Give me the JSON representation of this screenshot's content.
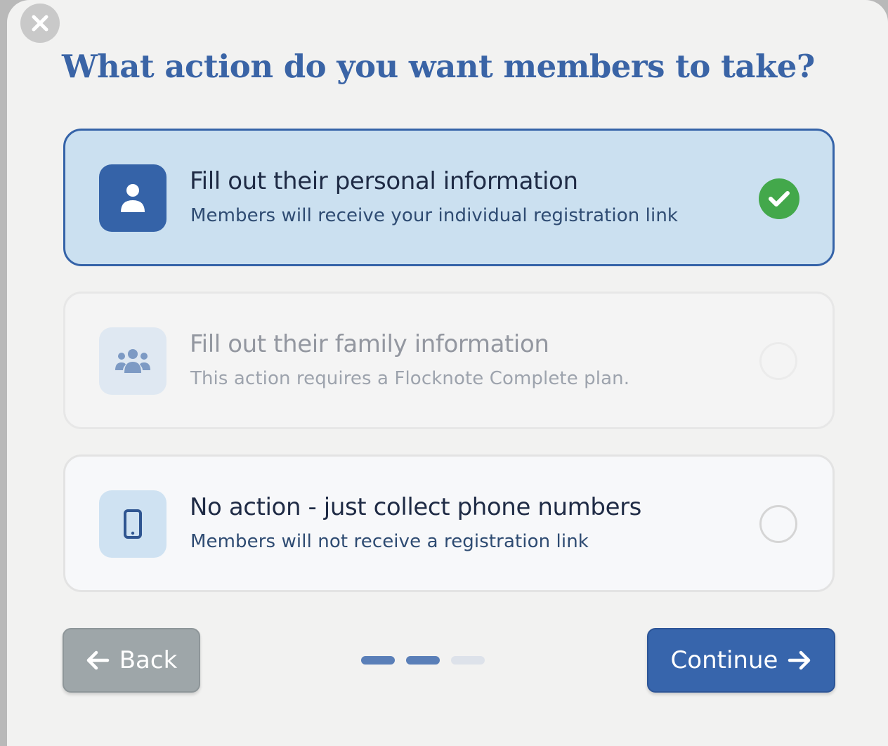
{
  "dialog": {
    "title": "What action do you want members to take?"
  },
  "options": [
    {
      "title": "Fill out their personal information",
      "description": "Members will receive your individual registration link",
      "icon": "person-icon",
      "state": "selected"
    },
    {
      "title": "Fill out their family information",
      "description": "This action requires a Flocknote Complete plan.",
      "icon": "group-icon",
      "state": "disabled"
    },
    {
      "title": "No action - just collect phone numbers",
      "description": "Members will not receive a registration link",
      "icon": "mobile-phone-icon",
      "state": "unselected"
    }
  ],
  "footer": {
    "back_label": "Back",
    "continue_label": "Continue",
    "steps_total": 3,
    "steps_completed": 2
  },
  "colors": {
    "title": "#3a64a6",
    "accent": "#3563a8",
    "selected_bg": "#cbe0f0",
    "check": "#43a84b",
    "back_button": "#9ea6a9",
    "continue_button": "#3765ac"
  }
}
